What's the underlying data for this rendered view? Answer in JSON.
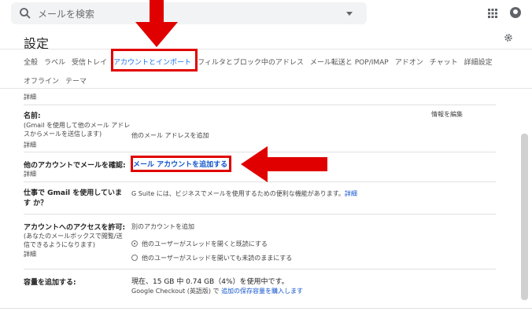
{
  "search": {
    "placeholder": "メールを検索"
  },
  "settings": {
    "title": "設定"
  },
  "tabs_row1": [
    "全般",
    "ラベル",
    "受信トレイ",
    "アカウントとインポート",
    "フィルタとブロック中のアドレス",
    "メール転送と POP/IMAP",
    "アドオン",
    "チャット",
    "詳細設定"
  ],
  "tabs_row2": [
    "オフライン",
    "テーマ"
  ],
  "rows": {
    "top_detail": "詳細",
    "name": {
      "label": "名前:",
      "desc": "(Gmail を使用して他のメール アドレスからメールを送信します)",
      "detail": "詳細",
      "add_address": "他のメール アドレスを追加",
      "edit_info": "情報を編集"
    },
    "check_other": {
      "label": "他のアカウントでメールを確認:",
      "detail": "詳細",
      "add_account": "メール アカウントを追加する"
    },
    "work": {
      "label": "仕事で Gmail を使用しています か？",
      "text_pre": "G Suite には、ビジネスでメールを使用するための便利な機能があります。",
      "detail": "詳細"
    },
    "grant": {
      "label": "アカウントへのアクセスを許可:",
      "desc": "(あなたのメールボックスで閲覧/送信できるようになります)",
      "detail": "詳細",
      "add_other": "別のアカウントを追加",
      "opt1": "他のユーザーがスレッドを開くと既読にする",
      "opt2": "他のユーザーがスレッドを開いても未読のままにする",
      "selected": 1
    },
    "storage": {
      "label": "容量を追加する:",
      "usage": "現在、15 GB 中 0.74 GB（4%）を使用中です。",
      "checkout": "Google Checkout (英語版) で",
      "buy": "追加の保存容量を購入します"
    }
  },
  "icons": {
    "search": "search-icon",
    "apps": "apps-grid-icon",
    "account": "account-circle-icon",
    "settings": "gear-icon"
  },
  "colors": {
    "accent": "#1a73e8",
    "link": "#1155cc",
    "highlight": "#e00000"
  }
}
